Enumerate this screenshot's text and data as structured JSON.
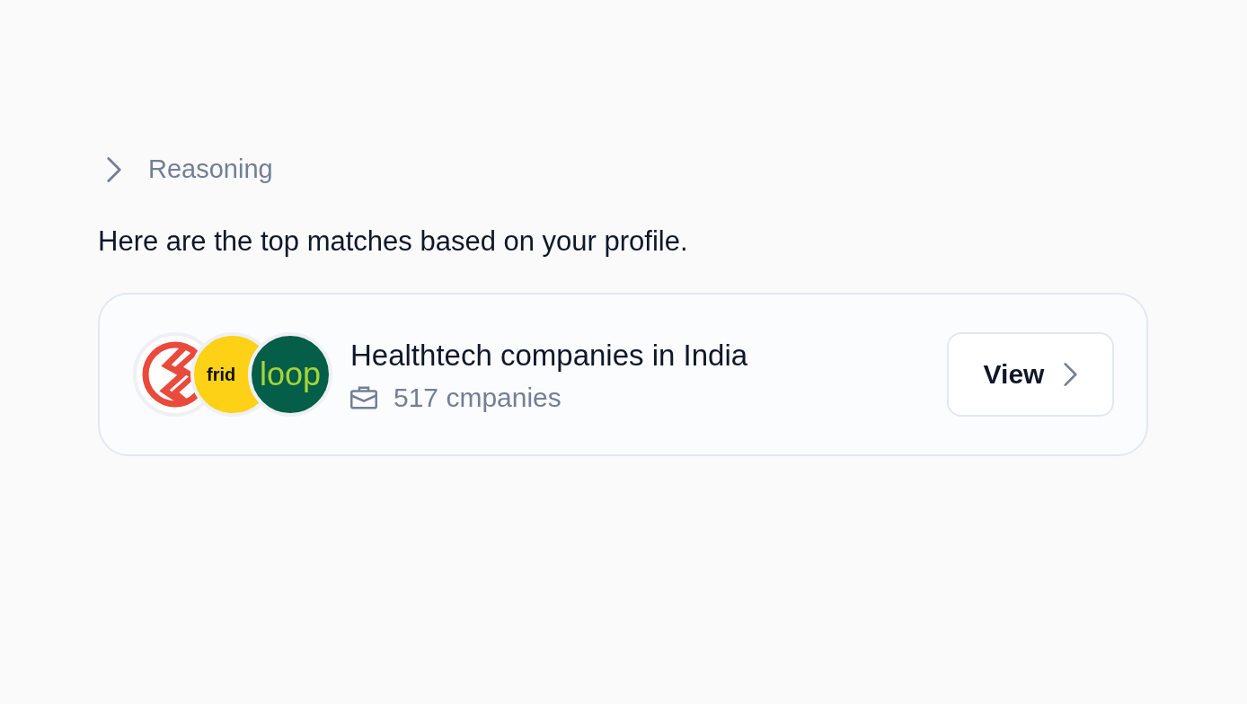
{
  "reasoning": {
    "label": "Reasoning",
    "expanded": false
  },
  "message": "Here are the top matches based on your profile.",
  "result_card": {
    "logos": [
      {
        "kind": "bolt"
      },
      {
        "kind": "wordmark",
        "text": "frid",
        "color": "#fcd116"
      },
      {
        "kind": "wordmark",
        "text": "loop",
        "color": "#045e48"
      }
    ],
    "title": "Healthtech companies in India",
    "count": "517 cmpanies",
    "button": "View"
  }
}
